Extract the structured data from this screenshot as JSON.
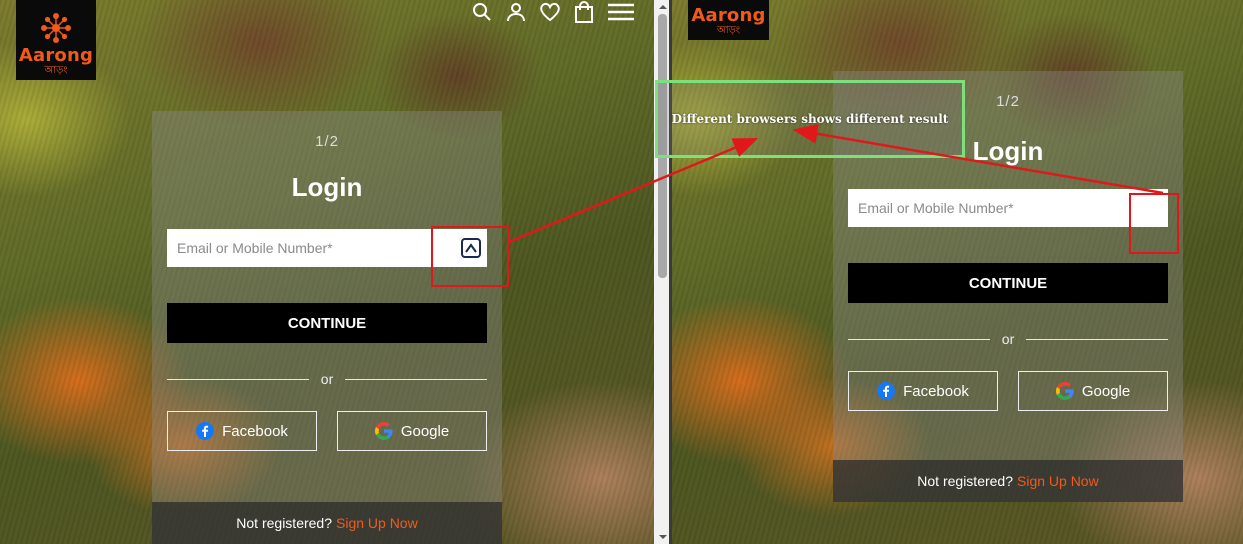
{
  "brand": {
    "name": "Aarong",
    "subtext": "আড়ং",
    "accent": "#f25a1c"
  },
  "header_icons": [
    "search-icon",
    "user-icon",
    "heart-icon",
    "bag-icon",
    "menu-icon"
  ],
  "login": {
    "step": "1/2",
    "title": "Login",
    "email_placeholder": "Email or Mobile Number*",
    "continue_label": "CONTINUE",
    "or_label": "or",
    "facebook_label": "Facebook",
    "google_label": "Google",
    "footer_text": "Not registered?",
    "signup_label": "Sign Up Now"
  },
  "annotation": {
    "callout_text": "Different browsers shows different result",
    "box_color": "#e0181b",
    "callout_border": "#7de07d"
  }
}
